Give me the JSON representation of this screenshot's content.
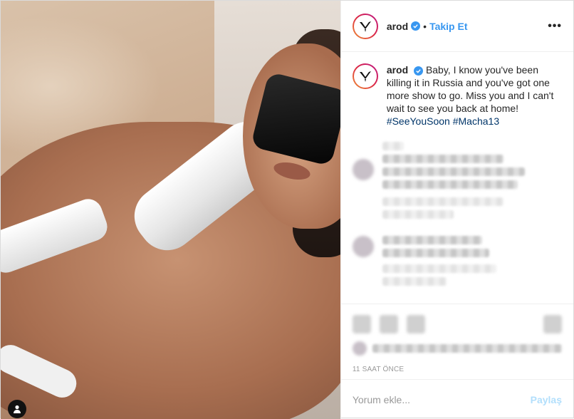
{
  "post": {
    "username": "arod",
    "follow_separator": "•",
    "follow_label": "Takip Et",
    "more_label": "•••",
    "caption": {
      "username": "arod",
      "text": "Baby, I know you've been killing it in Russia and you've got one more show to go. Miss you and I can't wait to see you back at home!",
      "hashtags": "#SeeYouSoon #Macha13"
    },
    "timestamp": "11 SAAT ÖNCE"
  },
  "comment_box": {
    "placeholder": "Yorum ekle...",
    "post_label": "Paylaş"
  },
  "colors": {
    "accent": "#3897f0",
    "hashtag": "#003569",
    "post_disabled": "#b2dffc"
  },
  "icons": [
    "more-options-icon",
    "verified-badge-icon",
    "user-tag-icon",
    "avatar-logo-icon"
  ]
}
